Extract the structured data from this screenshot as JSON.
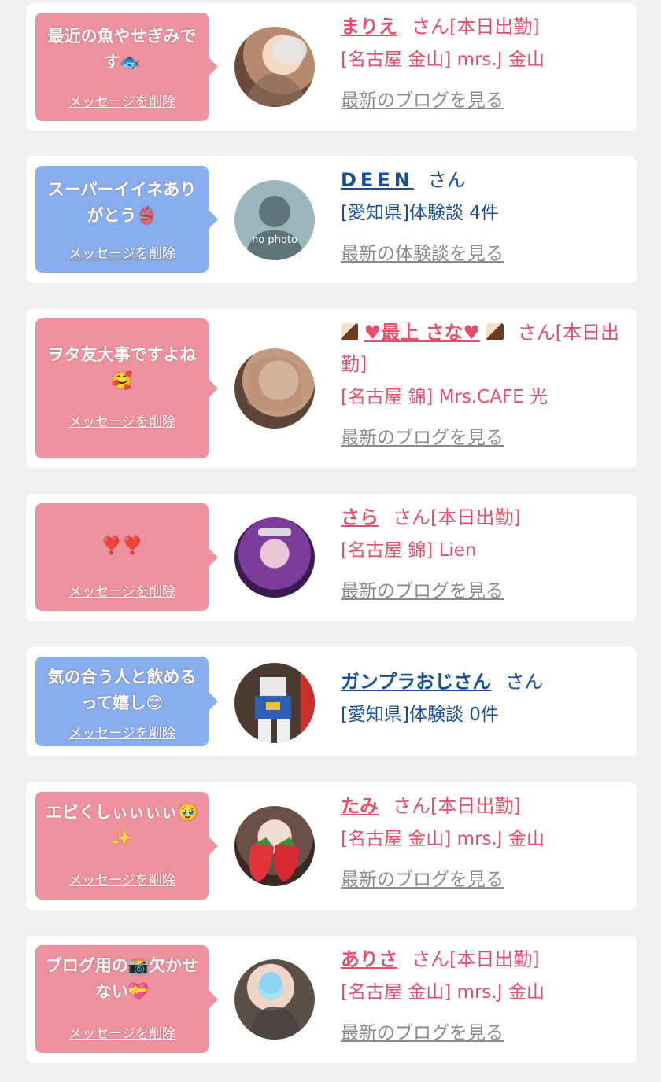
{
  "common": {
    "san": "さん",
    "delete_label": "メッセージを削除"
  },
  "items": [
    {
      "kind": "girl",
      "bubble_color": "#ef929f",
      "message": "最近の魚やせぎみです🐟",
      "name": "まりえ",
      "suffix": "さん[本日出勤]",
      "detail": "[名古屋 金山] mrs.J 金山",
      "link": "最新のブログを見る",
      "avatar_icon": "photo-avatar"
    },
    {
      "kind": "user",
      "bubble_color": "#88aeef",
      "message": "スーパーイイネありがとう👙",
      "name": "DEEN",
      "suffix": "さん",
      "detail": "[愛知県]体験談 4件",
      "link": "最新の体験談を見る",
      "avatar_icon": "no-photo-avatar",
      "avatar_text": "no photo"
    },
    {
      "kind": "girl",
      "bubble_color": "#ef929f",
      "message": "ヲタ友大事ですよね🥰",
      "name": "♥最上 さな♥",
      "suffix": "さん[本日出勤]",
      "detail": "[名古屋 錦] Mrs.CAFE 光",
      "link": "最新のブログを見る",
      "avatar_icon": "photo-avatar"
    },
    {
      "kind": "girl",
      "bubble_color": "#ef929f",
      "message": "❣️❣️",
      "name": "さら",
      "suffix": "さん[本日出勤]",
      "detail": "[名古屋 錦] Lien",
      "link": "最新のブログを見る",
      "avatar_icon": "photo-avatar"
    },
    {
      "kind": "user",
      "bubble_color": "#88aeef",
      "message": "気の合う人と飲めるって嬉し😊",
      "name": "ガンプラおじさん",
      "suffix": "さん",
      "detail": "[愛知県]体験談 0件",
      "link": "",
      "avatar_icon": "robot-figure-avatar"
    },
    {
      "kind": "girl",
      "bubble_color": "#ef929f",
      "message": "エビくしぃぃぃぃ🥹✨",
      "name": "たみ",
      "suffix": "さん[本日出勤]",
      "detail": "[名古屋 金山] mrs.J 金山",
      "link": "最新のブログを見る",
      "avatar_icon": "photo-avatar"
    },
    {
      "kind": "girl",
      "bubble_color": "#ef929f",
      "message": "ブログ用の📸欠かせない💝",
      "name": "ありさ",
      "suffix": "さん[本日出勤]",
      "detail": "[名古屋 金山] mrs.J 金山",
      "link": "最新のブログを見る",
      "avatar_icon": "photo-avatar"
    }
  ]
}
